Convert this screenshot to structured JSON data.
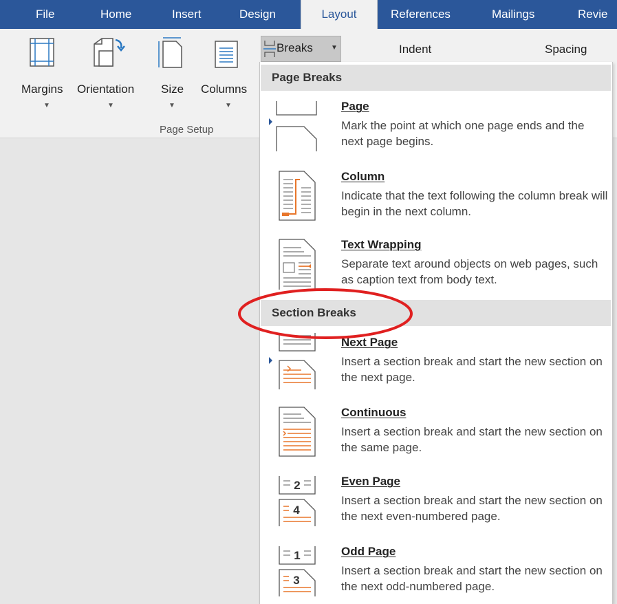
{
  "tabs": [
    {
      "label": "File"
    },
    {
      "label": "Home"
    },
    {
      "label": "Insert"
    },
    {
      "label": "Design"
    },
    {
      "label": "Layout",
      "active": true
    },
    {
      "label": "References"
    },
    {
      "label": "Mailings"
    },
    {
      "label": "Revie"
    }
  ],
  "ribbon": {
    "buttons": {
      "margins": "Margins",
      "orientation": "Orientation",
      "size": "Size",
      "columns": "Columns",
      "breaks": "Breaks"
    },
    "group_label": "Page Setup",
    "indent_label": "Indent",
    "spacing_label": "Spacing"
  },
  "menu": {
    "page_breaks_header": "Page Breaks",
    "section_breaks_header": "Section Breaks",
    "page_breaks": [
      {
        "title": "Page",
        "desc": "Mark the point at which one page ends and the next page begins.",
        "icon": "page-break-icon"
      },
      {
        "title": "Column",
        "desc": "Indicate that the text following the column break will begin in the next column.",
        "icon": "column-break-icon"
      },
      {
        "title": "Text Wrapping",
        "desc": "Separate text around objects on web pages, such as caption text from body text.",
        "icon": "text-wrapping-break-icon"
      }
    ],
    "section_breaks": [
      {
        "title": "Next Page",
        "desc": "Insert a section break and start the new section on the next page.",
        "icon": "next-page-break-icon"
      },
      {
        "title": "Continuous",
        "desc": "Insert a section break and start the new section on the same page.",
        "icon": "continuous-break-icon"
      },
      {
        "title": "Even Page",
        "desc": "Insert a section break and start the new section on the next even-numbered page.",
        "icon": "even-page-break-icon"
      },
      {
        "title": "Odd Page",
        "desc": "Insert a section break and start the new section on the next odd-numbered page.",
        "icon": "odd-page-break-icon"
      }
    ],
    "page_number_glyphs": {
      "even_top": "2",
      "even_bottom": "4",
      "odd_top": "1",
      "odd_bottom": "3"
    }
  },
  "colors": {
    "tab_bar": "#2b579a",
    "ribbon": "#f1f1f1",
    "accent_orange": "#e8762b",
    "highlight_circle": "#e02020"
  }
}
